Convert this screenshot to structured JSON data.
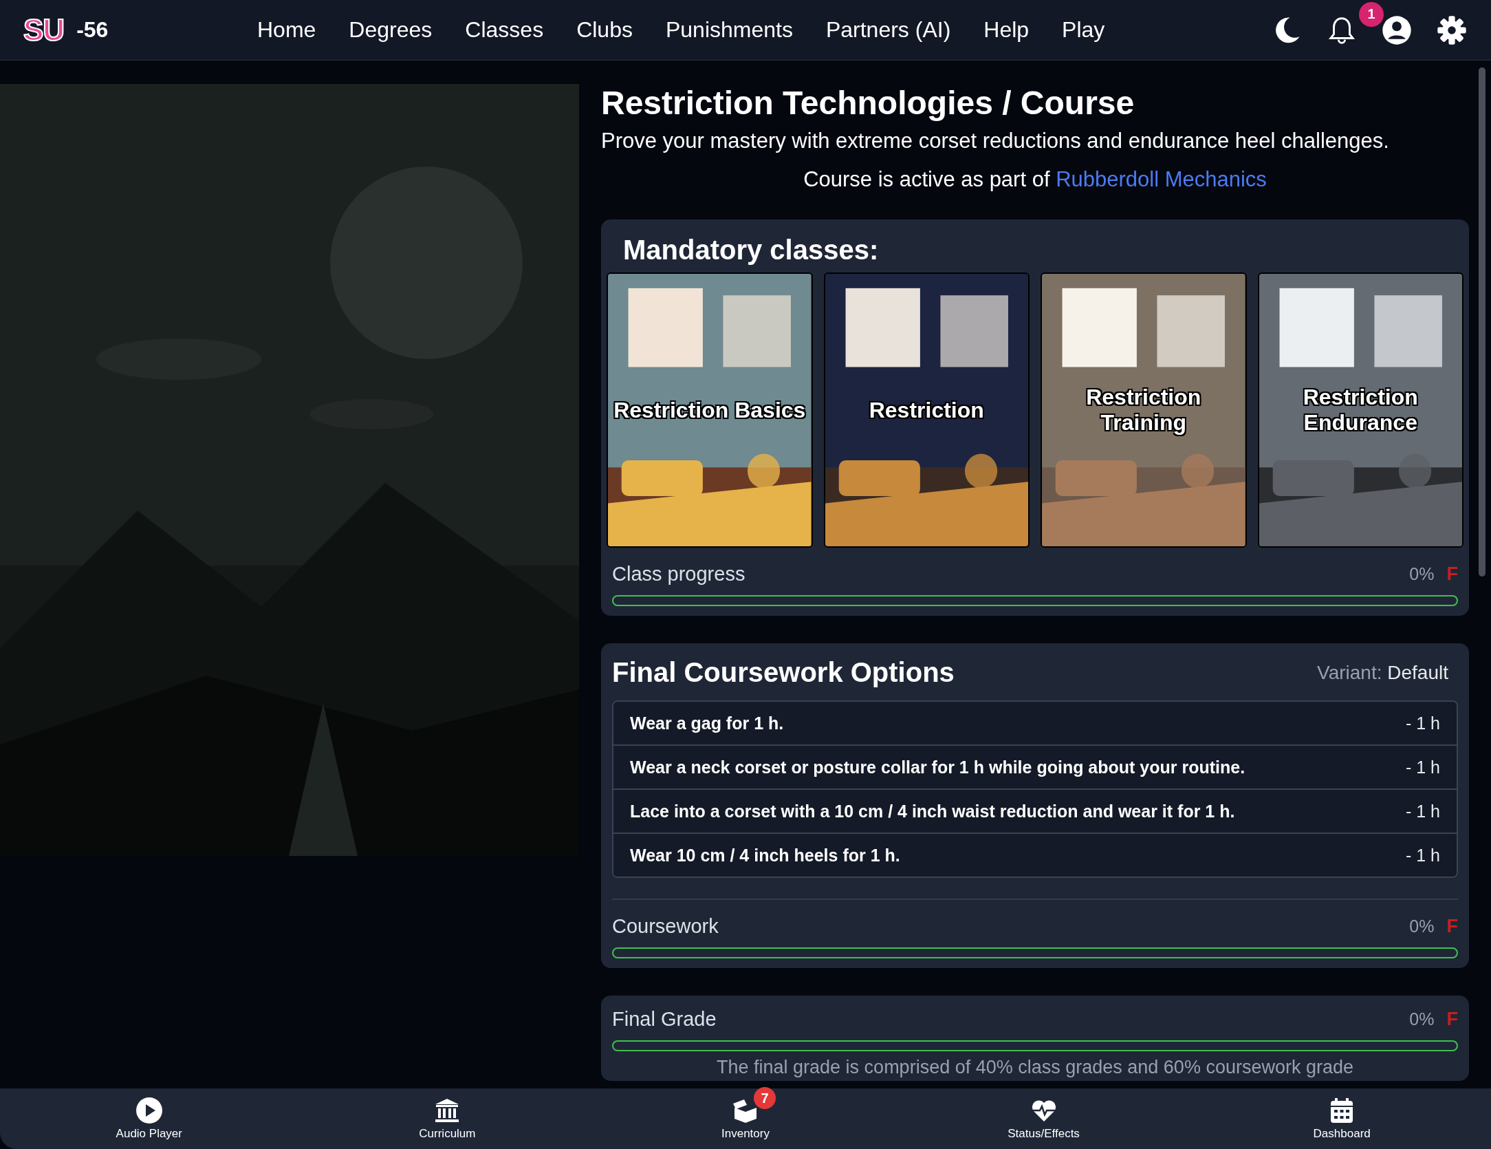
{
  "nav": {
    "logo": "SU",
    "score": "-56",
    "links": [
      "Home",
      "Degrees",
      "Classes",
      "Clubs",
      "Punishments",
      "Partners (AI)",
      "Help",
      "Play"
    ],
    "notification_count": "1"
  },
  "course": {
    "title": "Restriction Technologies / Course",
    "subtitle": "Prove your mastery with extreme corset reductions and endurance heel challenges.",
    "active_prefix": "Course is active as part of",
    "active_link": "Rubberdoll Mechanics"
  },
  "mandatory": {
    "heading": "Mandatory classes:",
    "classes": [
      {
        "title": "Restriction Basics"
      },
      {
        "title": "Restriction"
      },
      {
        "title": "Restriction Training"
      },
      {
        "title": "Restriction Endurance"
      }
    ],
    "progress": {
      "label": "Class progress",
      "percent": "0%",
      "grade": "F",
      "level": 0
    }
  },
  "coursework": {
    "heading": "Final Coursework Options",
    "variant_label": "Variant:",
    "variant": "Default",
    "options": [
      {
        "text": "Wear a gag for 1 h.",
        "duration": "- 1 h"
      },
      {
        "text": "Wear a neck corset or posture collar for 1 h while going about your routine.",
        "duration": "- 1 h"
      },
      {
        "text": "Lace into a corset with a 10 cm / 4 inch waist reduction and wear it for 1 h.",
        "duration": "- 1 h"
      },
      {
        "text": "Wear 10 cm / 4 inch heels for 1 h.",
        "duration": "- 1 h"
      }
    ],
    "progress": {
      "label": "Coursework",
      "percent": "0%",
      "grade": "F",
      "level": 0
    }
  },
  "final": {
    "label": "Final Grade",
    "percent": "0%",
    "grade": "F",
    "level": 0,
    "note": "The final grade is comprised of 40% class grades and 60% coursework grade"
  },
  "bottom_nav": [
    {
      "label": "Audio Player"
    },
    {
      "label": "Curriculum"
    },
    {
      "label": "Inventory",
      "badge": "7"
    },
    {
      "label": "Status/Effects"
    },
    {
      "label": "Dashboard"
    }
  ]
}
